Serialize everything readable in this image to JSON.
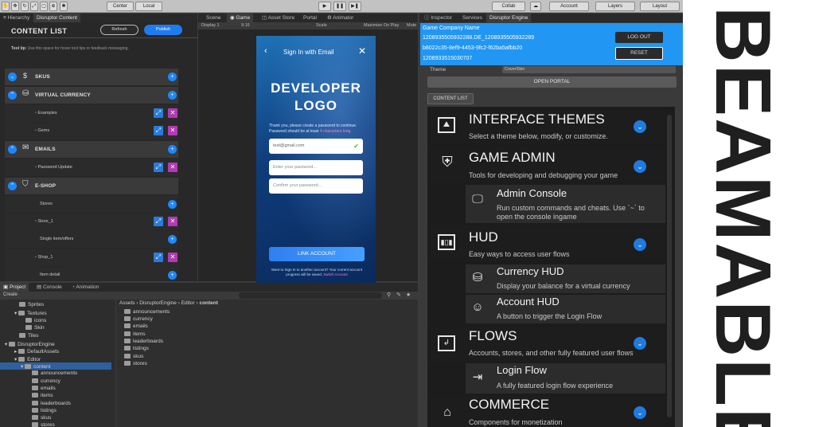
{
  "toolbar": {
    "center": "Center",
    "local": "Local",
    "collab": "Collab",
    "account": "Account",
    "layers": "Layers",
    "layout": "Layout"
  },
  "left_tabs": {
    "hierarchy": "Hierarchy",
    "disruptor": "Disruptor Content"
  },
  "content_list": {
    "title": "CONTENT LIST",
    "refresh": "Refresh",
    "publish": "Publish",
    "tooltip_label": "Tool tip:",
    "tooltip_text": "Use this space for hover tool tips or feedback messaging.",
    "rows": [
      {
        "label": "SKUS"
      },
      {
        "label": "VIRTUAL CURRENCY"
      },
      {
        "label": "Examples"
      },
      {
        "label": "Gems"
      },
      {
        "label": "EMAILS"
      },
      {
        "label": "Password Update"
      },
      {
        "label": "E-SHOP"
      },
      {
        "label": "Stores"
      },
      {
        "label": "Store_1"
      },
      {
        "label": "Single item/offers"
      },
      {
        "label": "Shop_1"
      },
      {
        "label": "Item detail"
      }
    ]
  },
  "game_tabs": {
    "scene": "Scene",
    "game": "Game",
    "asset_store": "Asset Store",
    "portal": "Portal",
    "animator": "Animator"
  },
  "game_bar": {
    "display": "Display 1",
    "aspect": "9:16",
    "scale": "Scale",
    "maximize": "Maximize On Play",
    "mute": "Mute"
  },
  "phone": {
    "header": "Sign In with Email",
    "logo_line1": "DEVELOPER",
    "logo_line2": "LOGO",
    "info": "Thank you, please create a password to continue. Password should be at least",
    "info_hint": "4 characters long.",
    "email_value": "test@gmail.com",
    "password_placeholder": "Enter your password...",
    "confirm_placeholder": "Confirm your password...",
    "link_button": "LINK ACCOUNT",
    "footer": "Want to Sign In to another account? Your current account progress will be saved.",
    "footer_link": "Switch Account"
  },
  "bottom_tabs": {
    "project": "Project",
    "console": "Console",
    "animation": "Animation"
  },
  "project": {
    "create": "Create",
    "tree": [
      "Sprites",
      "Textures",
      "icons",
      "Skin",
      "Tiles",
      "DisruptorEngine",
      "DefaultAssets",
      "Editor",
      "content",
      "announcements",
      "currency",
      "emails",
      "items",
      "leaderboards",
      "listings",
      "skus",
      "stores"
    ],
    "breadcrumb": [
      "Assets",
      "DisruptorEngine",
      "Editor",
      "content"
    ],
    "files": [
      "announcements",
      "currency",
      "emails",
      "items",
      "leaderboards",
      "listings",
      "skus",
      "stores"
    ]
  },
  "inspector_tabs": {
    "inspector": "Inspector",
    "services": "Services",
    "disruptor": "Disruptor Engine"
  },
  "inspector": {
    "company": "Game Company Name",
    "id1": "1208935505932288.DE_1208935505932289",
    "id2": "b8022c35-8ef9-4453-9fc2-f62ba5afbb20",
    "id3": "1208933515030707",
    "logout": "LOG OUT",
    "reset": "RESET",
    "theme_label": "Theme",
    "theme_value": "CoverSkin",
    "open_portal": "OPEN PORTAL",
    "content_list": "CONTENT LIST",
    "sections": [
      {
        "title": "INTERFACE THEMES",
        "desc": "Select a theme below, modify, or customize.",
        "icon": "image-icon"
      },
      {
        "title": "GAME ADMIN",
        "desc": "Tools for developing and debugging your game",
        "icon": "shield-star-icon"
      },
      {
        "title": "Admin Console",
        "desc": "Run custom commands and cheats. Use `~` to",
        "desc2": "open the console ingame",
        "icon": "monitor-icon"
      },
      {
        "title": "HUD",
        "desc": "Easy ways to access user flows",
        "icon": "hud-icon"
      },
      {
        "title": "Currency HUD",
        "desc": "Display your balance for a virtual currency",
        "icon": "currency-icon"
      },
      {
        "title": "Account HUD",
        "desc": "A button to trigger the Login Flow",
        "icon": "account-icon"
      },
      {
        "title": "FLOWS",
        "desc": "Accounts, stores, and other fully featured user flows",
        "icon": "flows-icon"
      },
      {
        "title": "Login Flow",
        "desc": "A fully featured login flow experience",
        "icon": "login-icon"
      },
      {
        "title": "COMMERCE",
        "desc": "Components for monetization",
        "icon": "store-icon"
      }
    ]
  },
  "brand": {
    "wordmark": "BEAMABLE",
    "color": "#1f1f1f",
    "accent": "#1a8fd0"
  }
}
